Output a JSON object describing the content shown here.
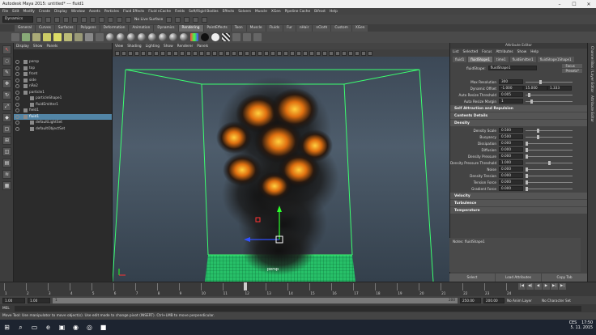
{
  "window": {
    "title": "Autodesk Maya 2015: untitled* --- fluid1",
    "controls": [
      "–",
      "☐",
      "✕"
    ]
  },
  "menubar": [
    "File",
    "Edit",
    "Modify",
    "Create",
    "Display",
    "Window",
    "Assets",
    "Particles",
    "Fluid Effects",
    "Fluid nCache",
    "Fields",
    "Soft/Rigid Bodies",
    "Effects",
    "Solvers",
    "Muscle",
    "XGen",
    "Pipeline Cache",
    "Bifrost",
    "Help"
  ],
  "statusline": {
    "menuset": "Dynamics",
    "live_surface": "No Live Surface"
  },
  "shelf": {
    "tabs": [
      "General",
      "Curves",
      "Surfaces",
      "Polygons",
      "Deformation",
      "Animation",
      "Dynamics",
      "Rendering",
      "PaintEffects",
      "Toon",
      "Muscle",
      "Fluids",
      "Fur",
      "nHair",
      "nCloth",
      "Custom",
      "XGen"
    ],
    "active": "Rendering"
  },
  "outliner": {
    "menu": [
      "Display",
      "Show",
      "Panels"
    ],
    "items": [
      {
        "label": "persp",
        "indent": 0
      },
      {
        "label": "top",
        "indent": 0
      },
      {
        "label": "front",
        "indent": 0
      },
      {
        "label": "side",
        "indent": 0
      },
      {
        "label": "nRe2",
        "indent": 0
      },
      {
        "label": "particle1",
        "indent": 0
      },
      {
        "label": "particleShape1",
        "indent": 1
      },
      {
        "label": "fluidEmitter1",
        "indent": 1
      },
      {
        "label": "field1",
        "indent": 0
      },
      {
        "label": "fluid1",
        "indent": 0,
        "selected": true
      },
      {
        "label": "defaultLightSet",
        "indent": 1
      },
      {
        "label": "defaultObjectSet",
        "indent": 1
      }
    ]
  },
  "viewport": {
    "menu": [
      "View",
      "Shading",
      "Lighting",
      "Show",
      "Renderer",
      "Panels"
    ],
    "camera": "persp"
  },
  "attr_editor": {
    "title": "Attribute Editor",
    "menu": [
      "List",
      "Selected",
      "Focus",
      "Attributes",
      "Show",
      "Help"
    ],
    "tabs": [
      "fluid1",
      "fluidShape1",
      "time1",
      "fluidEmitter1",
      "fluidShape1Shape1"
    ],
    "active_tab": "fluidShape1",
    "shape_label": "fluidShape:",
    "shape_value": "fluidShape1",
    "focus_btn": "Focus",
    "presets_btn": "Presets*",
    "top_rows": [
      {
        "label": "Max Resolution",
        "value": "300",
        "slider": 0.3
      },
      {
        "label": "Dynamic Offset",
        "value": "-1.000",
        "v2": "15.000",
        "v3": "1.333"
      },
      {
        "label": "Auto Resize Threshold",
        "value": "0.005",
        "slider": 0.05
      },
      {
        "label": "Auto Resize Margin",
        "value": "1",
        "slider": 0.1
      }
    ],
    "sections": [
      "Self Attraction and Repulsion",
      "Contents Details"
    ],
    "density_title": "Density",
    "density_rows": [
      {
        "label": "Density Scale",
        "value": "0.500",
        "slider": 0.25
      },
      {
        "label": "Buoyancy",
        "value": "0.500",
        "slider": 0.25
      },
      {
        "label": "Dissipation",
        "value": "0.000",
        "slider": 0.0
      },
      {
        "label": "Diffusion",
        "value": "0.000",
        "slider": 0.0
      },
      {
        "label": "Density Pressure",
        "value": "0.000",
        "slider": 0.0
      },
      {
        "label": "Density Pressure Threshold",
        "value": "1.000",
        "slider": 0.5
      },
      {
        "label": "Noise",
        "value": "0.000",
        "slider": 0.0
      },
      {
        "label": "Density Tension",
        "value": "0.000",
        "slider": 0.0
      },
      {
        "label": "Tension Force",
        "value": "0.000",
        "slider": 0.0
      },
      {
        "label": "Gradient Force",
        "value": "0.000",
        "slider": 0.0
      }
    ],
    "more_sections": [
      "Velocity",
      "Turbulence",
      "Temperature"
    ],
    "notes": "Notes: fluidShape1",
    "buttons": [
      "Select",
      "Load Attributes",
      "Copy Tab"
    ],
    "side_tabs": [
      "Channel Box / Layer Editor",
      "Attribute Editor"
    ]
  },
  "timeline": {
    "ticks": [
      "1",
      "2",
      "3",
      "4",
      "5",
      "6",
      "7",
      "8",
      "9",
      "10",
      "11",
      "12",
      "13",
      "14",
      "15",
      "16",
      "17",
      "18",
      "19",
      "20",
      "21",
      "22",
      "23",
      "24"
    ],
    "current": "12",
    "play_controls": [
      "|◀",
      "◀|",
      "◀",
      "▶",
      "▶|",
      "▶|"
    ]
  },
  "range": {
    "start": "1.00",
    "inner_start": "1.00",
    "current": "1",
    "end_inner": "200",
    "end": "250.00",
    "end2": "200.00",
    "anim_layer": "No Anim Layer",
    "char_set": "No Character Set"
  },
  "cmdline": {
    "label": "MEL"
  },
  "helpline": "Move Tool: Use manipulator to move object(s). Use edit mode to change pivot (INSERT). Ctrl+LMB to move perpendicular.",
  "taskbar": {
    "icons": [
      "⊞",
      "⌕",
      "▭",
      "e",
      "▣",
      "◉",
      "◎",
      "■"
    ],
    "lang": "CES",
    "time": "17:50",
    "date": "5. 11. 2015"
  }
}
